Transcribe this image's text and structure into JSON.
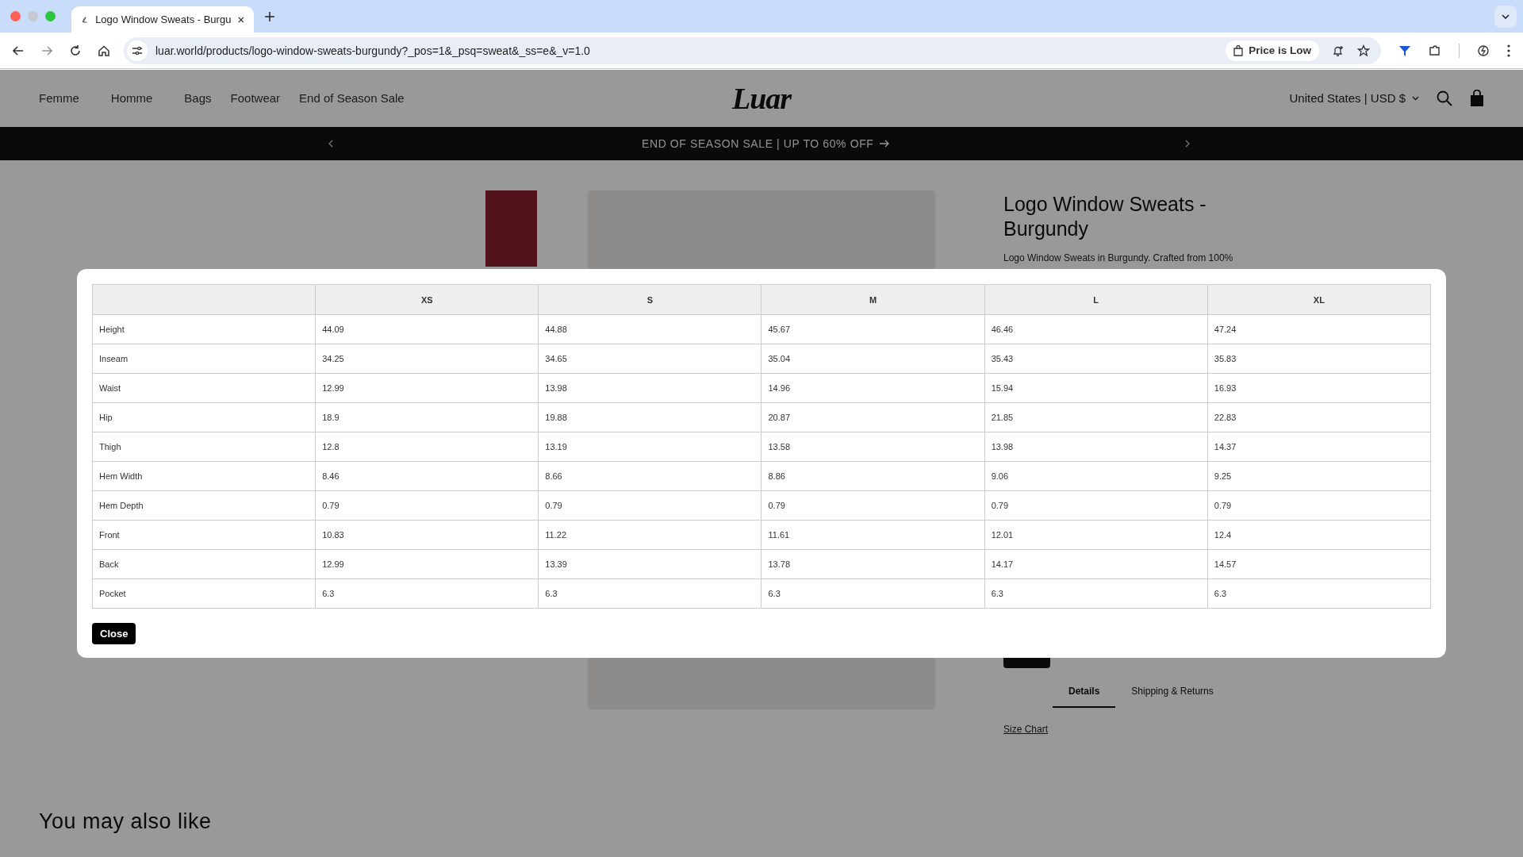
{
  "browser": {
    "tab_title": "Logo Window Sweats - Burgu",
    "url": "luar.world/products/logo-window-sweats-burgundy?_pos=1&_psq=sweat&_ss=e&_v=1.0",
    "price_chip": "Price is Low"
  },
  "nav": {
    "links": [
      "Femme",
      "Homme",
      "Bags",
      "Footwear",
      "End of Season Sale"
    ],
    "logo": "Luar",
    "region": "United States | USD $"
  },
  "announcement": "END OF SEASON SALE | UP TO 60% OFF",
  "product": {
    "title": "Logo Window Sweats - Burgundy",
    "description": "Logo Window Sweats in Burgundy. Crafted from 100%",
    "tabs": [
      {
        "label": "Details",
        "selected": true
      },
      {
        "label": "Shipping & Returns",
        "selected": false
      }
    ],
    "size_chart_link": "Size Chart"
  },
  "recommendations": {
    "heading": "You may also like"
  },
  "size_chart": {
    "columns": [
      "XS",
      "S",
      "M",
      "L",
      "XL"
    ],
    "rows": [
      {
        "measure": "Height",
        "values": [
          "44.09",
          "44.88",
          "45.67",
          "46.46",
          "47.24"
        ]
      },
      {
        "measure": "Inseam",
        "values": [
          "34.25",
          "34.65",
          "35.04",
          "35.43",
          "35.83"
        ]
      },
      {
        "measure": "Waist",
        "values": [
          "12.99",
          "13.98",
          "14.96",
          "15.94",
          "16.93"
        ]
      },
      {
        "measure": "Hip",
        "values": [
          "18.9",
          "19.88",
          "20.87",
          "21.85",
          "22.83"
        ]
      },
      {
        "measure": "Thigh",
        "values": [
          "12.8",
          "13.19",
          "13.58",
          "13.98",
          "14.37"
        ]
      },
      {
        "measure": "Hem Width",
        "values": [
          "8.46",
          "8.66",
          "8.86",
          "9.06",
          "9.25"
        ]
      },
      {
        "measure": "Hem Depth",
        "values": [
          "0.79",
          "0.79",
          "0.79",
          "0.79",
          "0.79"
        ]
      },
      {
        "measure": "Front",
        "values": [
          "10.83",
          "11.22",
          "11.61",
          "12.01",
          "12.4"
        ]
      },
      {
        "measure": "Back",
        "values": [
          "12.99",
          "13.39",
          "13.78",
          "14.17",
          "14.57"
        ]
      },
      {
        "measure": "Pocket",
        "values": [
          "6.3",
          "6.3",
          "6.3",
          "6.3",
          "6.3"
        ]
      }
    ],
    "close_button": "Close"
  }
}
